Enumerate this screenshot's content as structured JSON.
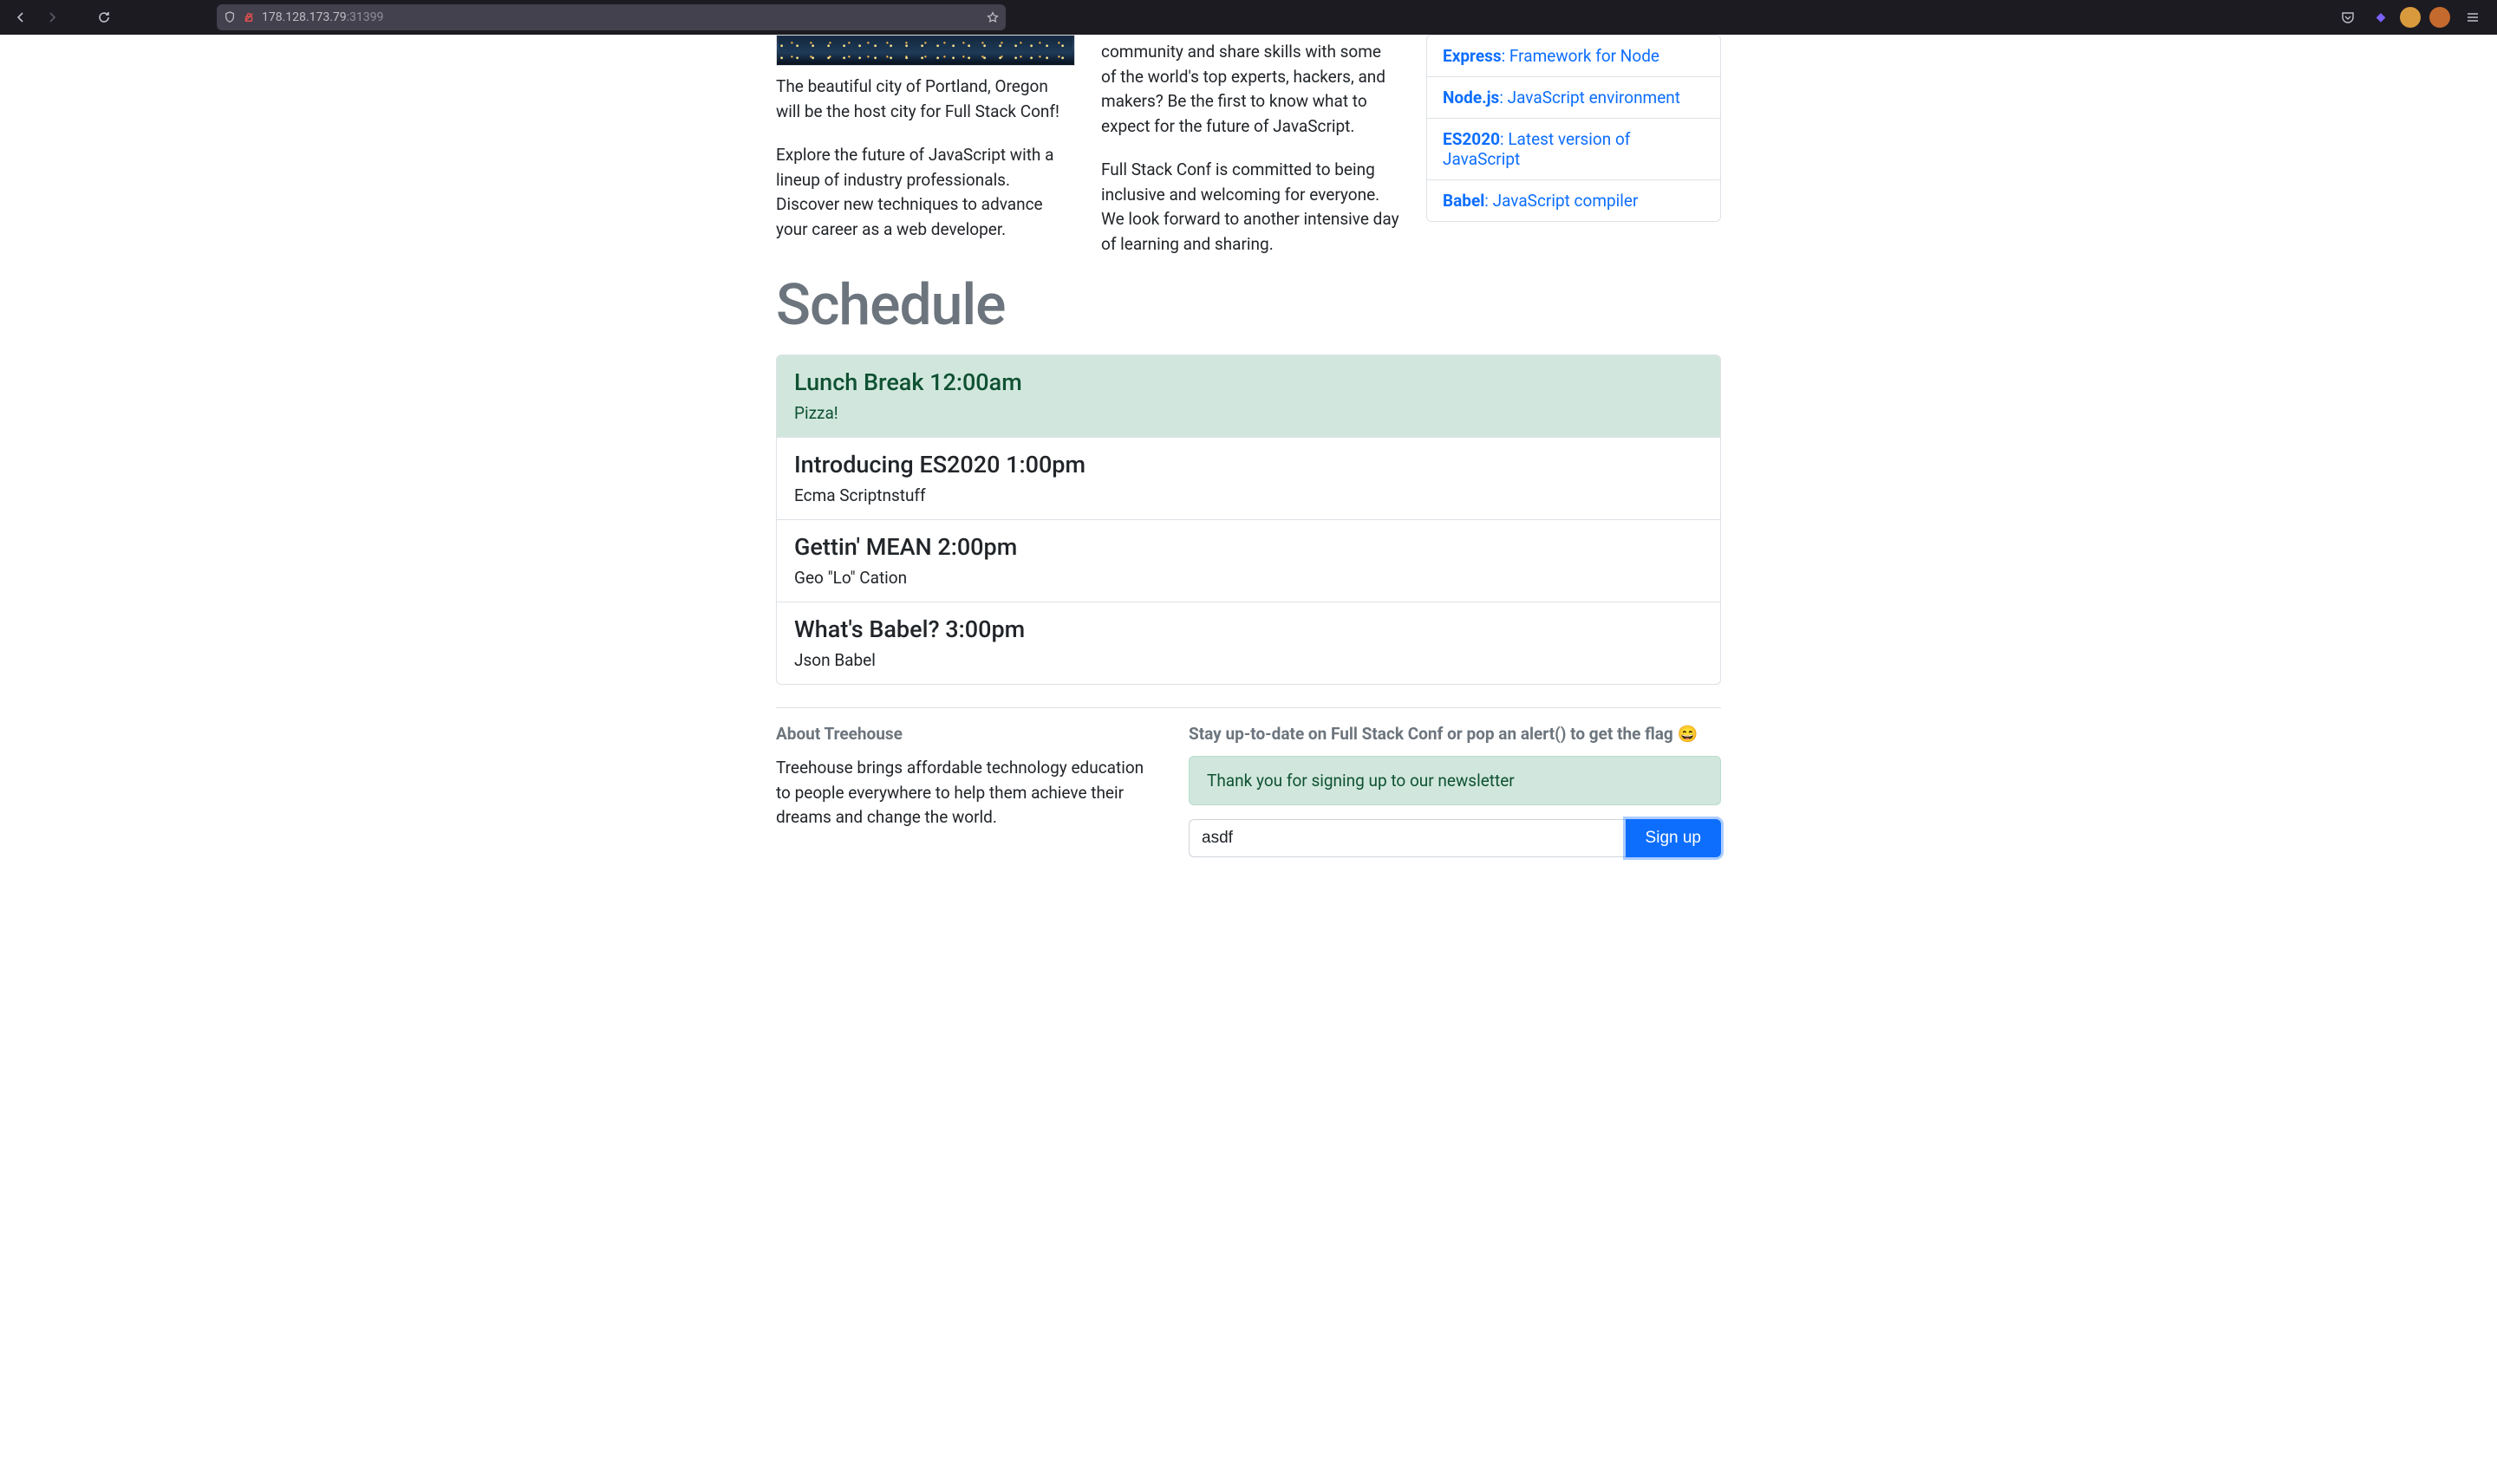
{
  "browser": {
    "url_main": "178.128.173.79",
    "url_port": ":31399"
  },
  "intro": {
    "img_caption": "The beautiful city of Portland, Oregon will be the host city for Full Stack Conf!",
    "col1_p2": "Explore the future of JavaScript with a lineup of industry professionals. Discover new techniques to advance your career as a web developer.",
    "col2_p1": "community and share skills with some of the world's top experts, hackers, and makers? Be the first to know what to expect for the future of JavaScript.",
    "col2_p2": "Full Stack Conf is committed to being inclusive and welcoming for everyone. We look forward to another intensive day of learning and sharing."
  },
  "tech": [
    {
      "name": "Express",
      "desc": ": Framework for Node"
    },
    {
      "name": "Node.js",
      "desc": ": JavaScript environment"
    },
    {
      "name": "ES2020",
      "desc": ": Latest version of JavaScript"
    },
    {
      "name": "Babel",
      "desc": ": JavaScript compiler"
    }
  ],
  "schedule_heading": "Schedule",
  "schedule": [
    {
      "title": "Lunch Break 12:00am",
      "sub": "Pizza!",
      "variant": "success"
    },
    {
      "title": "Introducing ES2020 1:00pm",
      "sub": "Ecma Scriptnstuff",
      "variant": ""
    },
    {
      "title": "Gettin' MEAN 2:00pm",
      "sub": "Geo \"Lo\" Cation",
      "variant": ""
    },
    {
      "title": "What's Babel? 3:00pm",
      "sub": "Json Babel",
      "variant": ""
    }
  ],
  "footer": {
    "about_title": "About Treehouse",
    "about_body": "Treehouse brings affordable technology education to people everywhere to help them achieve their dreams and change the world.",
    "signup_title": "Stay up-to-date on Full Stack Conf or pop an alert() to get the flag 😄",
    "alert": "Thank you for signing up to our newsletter",
    "input_value": "asdf",
    "button": "Sign up"
  }
}
